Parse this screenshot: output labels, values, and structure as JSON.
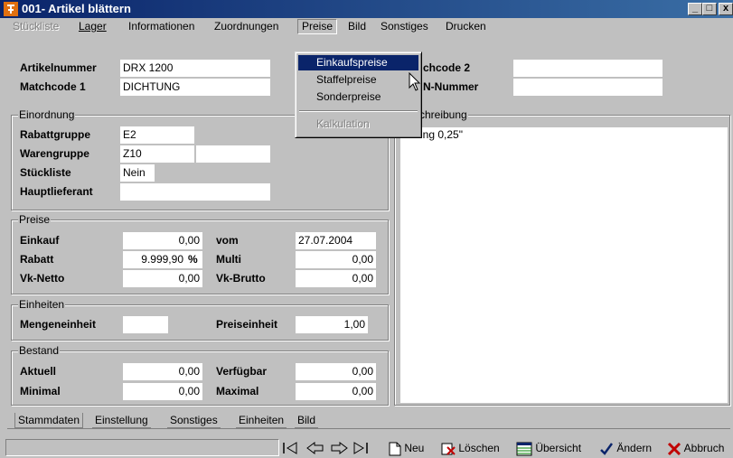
{
  "window": {
    "title": "001- Artikel blättern",
    "controls": {
      "minimize": "_",
      "maximize": "□",
      "close": "x"
    }
  },
  "menu": {
    "items": [
      "Stückliste",
      "Lager",
      "Informationen",
      "Zuordnungen",
      "Preise",
      "Bild",
      "Sonstiges",
      "Drucken"
    ],
    "open": "Preise",
    "dropdown": [
      "Einkaufspreise",
      "Staffelpreise",
      "Sonderpreise",
      "Kalkulation"
    ]
  },
  "header": {
    "artikelnummer_label": "Artikelnummer",
    "artikelnummer_value": "DRX 1200",
    "matchcode1_label": "Matchcode 1",
    "matchcode1_value": "DICHTUNG",
    "matchcode2_label": "chcode 2",
    "ean_label": "N-Nummer"
  },
  "einordnung": {
    "title": "Einordnung",
    "rabattgruppe_label": "Rabattgruppe",
    "rabattgruppe_value": "E2",
    "warengruppe_label": "Warengruppe",
    "warengruppe_value": "Z10",
    "stueckliste_label": "Stückliste",
    "stueckliste_value": "Nein",
    "hauptlieferant_label": "Hauptlieferant"
  },
  "beschreibung": {
    "title": "chreibung",
    "text": "chtung 0,25\""
  },
  "preise": {
    "title": "Preise",
    "einkauf_label": "Einkauf",
    "einkauf_value": "0,00",
    "vom_label": "vom",
    "vom_value": "27.07.2004",
    "rabatt_label": "Rabatt",
    "rabatt_value": "9.999,90",
    "rabatt_unit": "%",
    "multi_label": "Multi",
    "multi_value": "0,00",
    "vknetto_label": "Vk-Netto",
    "vknetto_value": "0,00",
    "vkbrutto_label": "Vk-Brutto",
    "vkbrutto_value": "0,00"
  },
  "einheiten": {
    "title": "Einheiten",
    "mengeneinheit_label": "Mengeneinheit",
    "preiseinheit_label": "Preiseinheit",
    "preiseinheit_value": "1,00"
  },
  "bestand": {
    "title": "Bestand",
    "aktuell_label": "Aktuell",
    "aktuell_value": "0,00",
    "verfuegbar_label": "Verfügbar",
    "verfuegbar_value": "0,00",
    "minimal_label": "Minimal",
    "minimal_value": "0,00",
    "maximal_label": "Maximal",
    "maximal_value": "0,00"
  },
  "tabs": [
    "Stammdaten",
    "Einstellung",
    "Sonstiges",
    "Einheiten",
    "Bild"
  ],
  "toolbar": {
    "neu": "Neu",
    "loeschen": "Löschen",
    "uebersicht": "Übersicht",
    "aendern": "Ändern",
    "abbruch": "Abbruch"
  },
  "colors": {
    "title_bar": "#0a246a",
    "face": "#c0c0c0",
    "selection": "#0a246a",
    "field": "#ffffff"
  }
}
